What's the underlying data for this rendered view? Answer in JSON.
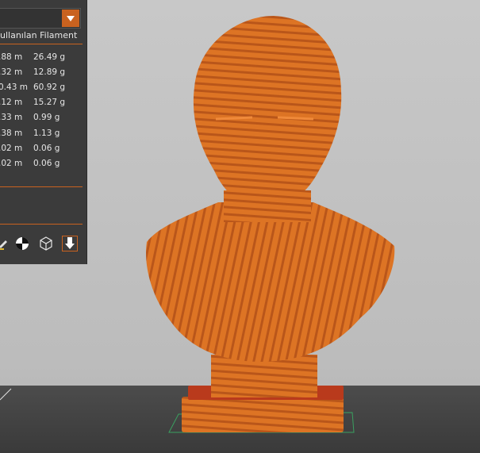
{
  "panel": {
    "header": "ullanılan Filament",
    "rows": [
      {
        "length": ".88 m",
        "weight": "26.49 g"
      },
      {
        "length": ".32 m",
        "weight": "12.89 g"
      },
      {
        "length": "0.43 m",
        "weight": "60.92 g"
      },
      {
        "length": ".12 m",
        "weight": "15.27 g"
      },
      {
        "length": ".33 m",
        "weight": "0.99 g"
      },
      {
        "length": ".38 m",
        "weight": "1.13 g"
      },
      {
        "length": ".02 m",
        "weight": "0.06 g"
      },
      {
        "length": ".02 m",
        "weight": "0.06 g"
      }
    ]
  },
  "toolbar": {
    "icons": [
      "paint-icon",
      "color-mode-icon",
      "wireframe-cube-icon",
      "export-download-icon"
    ]
  },
  "colors": {
    "accent": "#c9621f",
    "panel_bg": "#3b3b3b",
    "model": "#d9701f",
    "viewport_bg": "#c4c4c4",
    "bed": "#444444"
  }
}
